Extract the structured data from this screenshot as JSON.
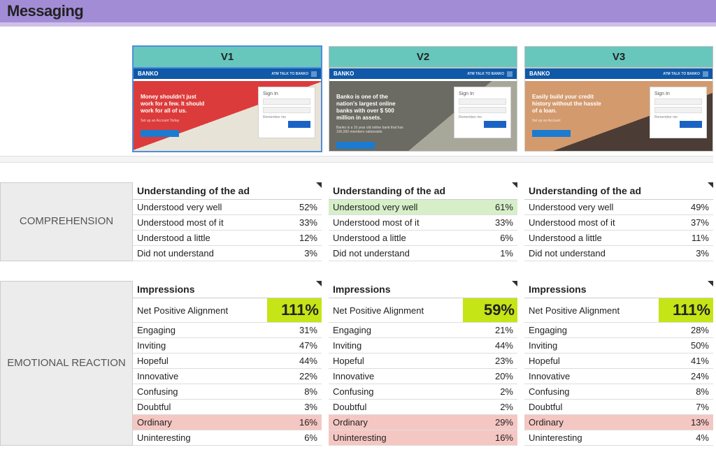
{
  "banner": "Messaging",
  "variants": [
    {
      "id": "v1",
      "label": "V1",
      "thumb": {
        "brand": "BANKO",
        "nav": "ATM   TALK TO BANKO",
        "tagline": "Money shouldn't just work for a few. It should work for all of us.",
        "sub": "Set up an Account Today",
        "signin": "Sign In",
        "remember": "Remember me"
      }
    },
    {
      "id": "v2",
      "label": "V2",
      "thumb": {
        "brand": "BANKO",
        "nav": "ATM   TALK TO BANKO",
        "tagline": "Banko is one of the nation's largest online banks with over $ 500 million in assets.",
        "sub": "Banko is a 10 year old online bank that has 100,000 members nationwide",
        "signin": "Sign In",
        "remember": "Remember me"
      }
    },
    {
      "id": "v3",
      "label": "V3",
      "thumb": {
        "brand": "BANKO",
        "nav": "ATM   TALK TO BANKO",
        "tagline": "Easily build your credit history without the hassle of a loan.",
        "sub": "Set up an Account",
        "signin": "Sign In",
        "remember": "Remember me"
      }
    }
  ],
  "sections": {
    "comprehension": {
      "rowLabel": "COMPREHENSION",
      "header": "Understanding of the ad",
      "metrics": [
        "Understood very well",
        "Understood most of it",
        "Understood a little",
        "Did not understand"
      ],
      "values": {
        "v1": [
          "52%",
          "33%",
          "12%",
          "3%"
        ],
        "v2": [
          "61%",
          "33%",
          "6%",
          "1%"
        ],
        "v3": [
          "49%",
          "37%",
          "11%",
          "3%"
        ]
      },
      "hl": {
        "v2": {
          "0": "green"
        }
      }
    },
    "emotional": {
      "rowLabel": "EMOTIONAL REACTION",
      "header": "Impressions",
      "npaLabel": "Net Positive Alignment",
      "npa": {
        "v1": "111%",
        "v2": "59%",
        "v3": "111%"
      },
      "metrics": [
        "Engaging",
        "Inviting",
        "Hopeful",
        "Innovative",
        "Confusing",
        "Doubtful",
        "Ordinary",
        "Uninteresting"
      ],
      "values": {
        "v1": [
          "31%",
          "47%",
          "44%",
          "22%",
          "8%",
          "3%",
          "16%",
          "6%"
        ],
        "v2": [
          "21%",
          "44%",
          "23%",
          "20%",
          "2%",
          "2%",
          "29%",
          "16%"
        ],
        "v3": [
          "28%",
          "50%",
          "41%",
          "24%",
          "8%",
          "7%",
          "13%",
          "4%"
        ]
      },
      "hl": {
        "v1": {
          "6": "red"
        },
        "v2": {
          "6": "red",
          "7": "red"
        },
        "v3": {
          "6": "red"
        }
      }
    }
  }
}
